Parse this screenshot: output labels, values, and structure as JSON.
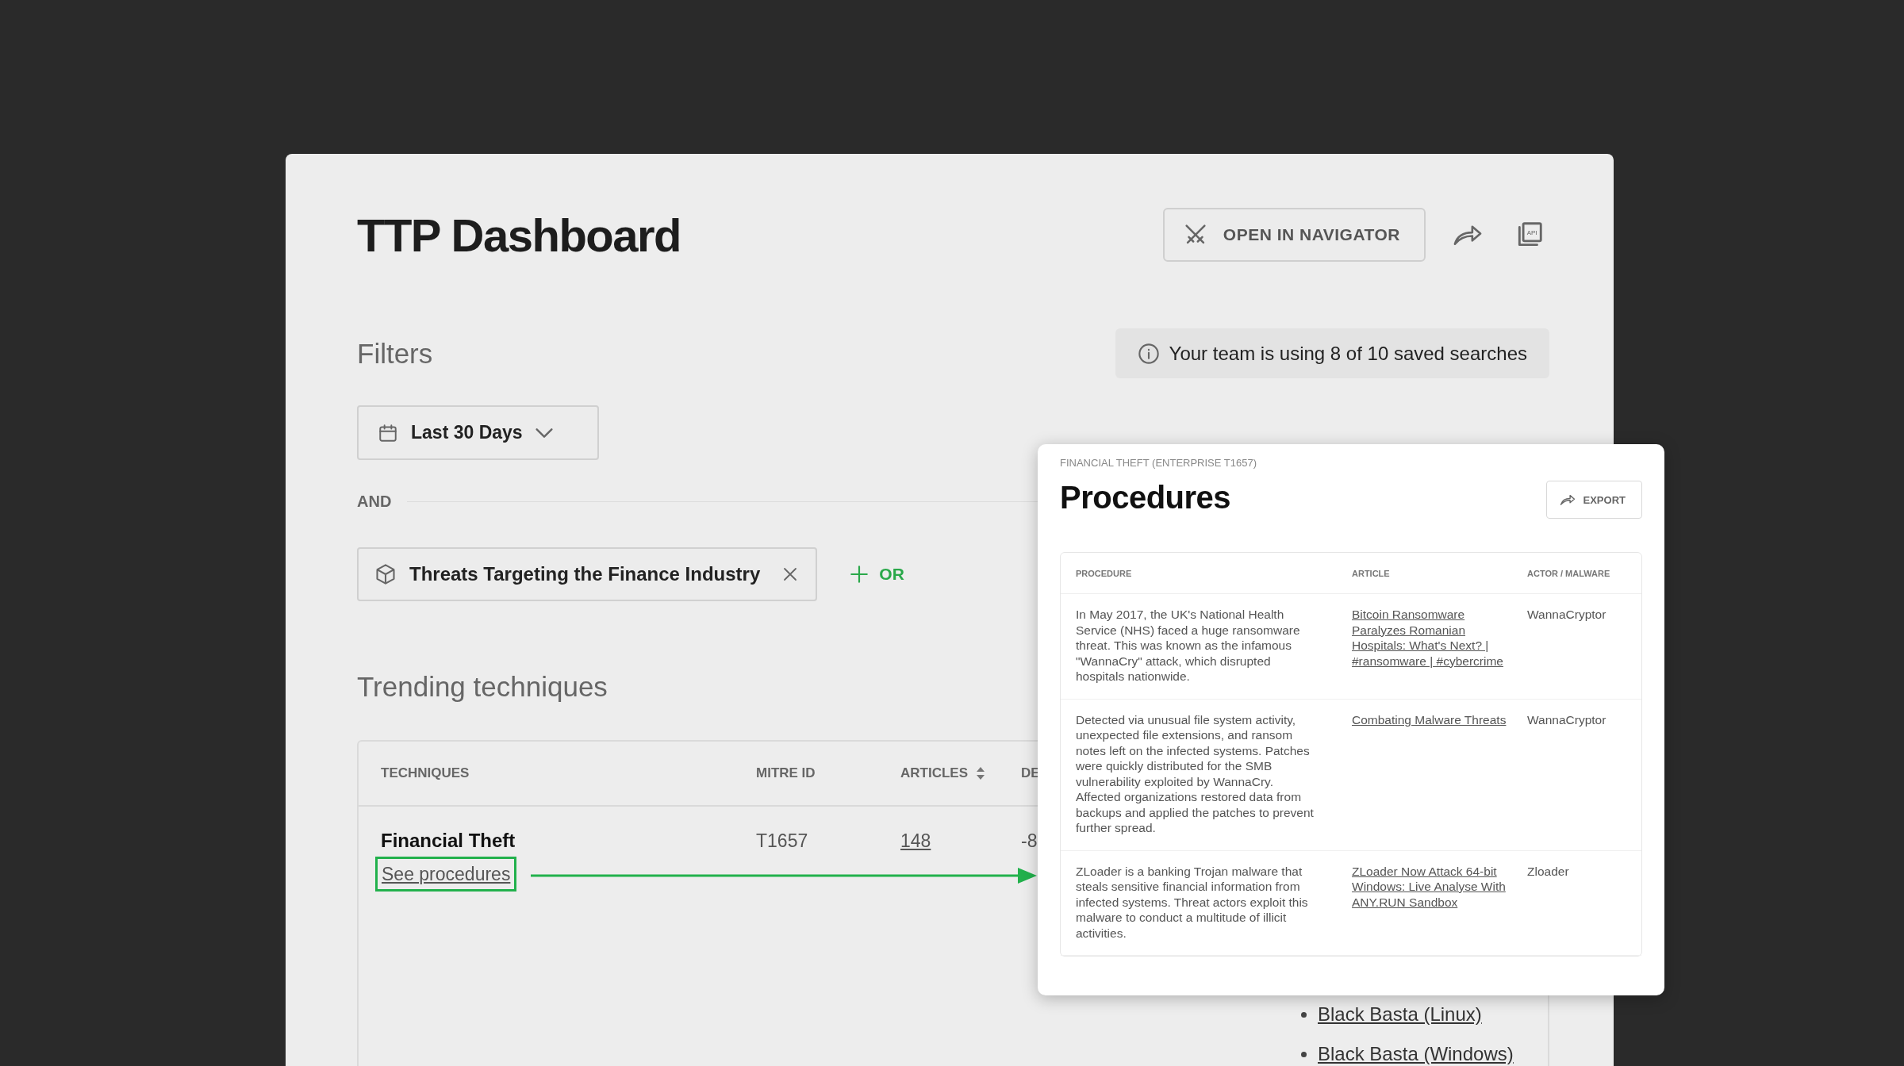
{
  "page": {
    "title": "TTP Dashboard",
    "navigator_button": "OPEN IN NAVIGATOR",
    "api_label": "API"
  },
  "filters": {
    "heading": "Filters",
    "notice": "Your team is using 8 of 10 saved searches",
    "date_range": "Last 30 Days",
    "operator": "AND",
    "chips": [
      {
        "label": "Threats Targeting the Finance Industry"
      }
    ],
    "add_button": "OR"
  },
  "trending": {
    "heading": "Trending techniques",
    "columns": [
      "TECHNIQUES",
      "MITRE ID",
      "ARTICLES",
      "DE"
    ],
    "rows": [
      {
        "technique": "Financial Theft",
        "link": "See procedures",
        "highlighted": true,
        "mitre_id": "T1657",
        "articles": "148",
        "column_4": "-8",
        "column_5": [
          "Black Basta (Linux)",
          "Black Basta (Windows)"
        ]
      }
    ]
  },
  "procedures_panel": {
    "eyebrow": "FINANCIAL THEFT (ENTERPRISE T1657)",
    "title": "Procedures",
    "export_button": "EXPORT",
    "columns": [
      "PROCEDURE",
      "ARTICLE",
      "ACTOR / MALWARE"
    ],
    "rows": [
      {
        "procedure": "In May 2017, the UK's National Health Service (NHS) faced a huge ransomware threat. This was known as the infamous \"WannaCry\" attack, which disrupted hospitals nationwide.",
        "article": "Bitcoin Ransomware Paralyzes Romanian Hospitals: What's Next? | #ransomware | #cybercrime",
        "actor": "WannaCryptor"
      },
      {
        "procedure": "Detected via unusual file system activity, unexpected file extensions, and ransom notes left on the infected systems. Patches were quickly distributed for the SMB vulnerability exploited by WannaCry. Affected organizations restored data from backups and applied the patches to prevent further spread.",
        "article": "Combating Malware Threats",
        "actor": "WannaCryptor"
      },
      {
        "procedure": "ZLoader is a banking Trojan malware that steals sensitive financial information from infected systems. Threat actors exploit this malware to conduct a multitude of illicit activities.",
        "article": "ZLoader Now Attack 64-bit Windows: Live Analyse With ANY.RUN Sandbox",
        "actor": "Zloader"
      }
    ]
  }
}
